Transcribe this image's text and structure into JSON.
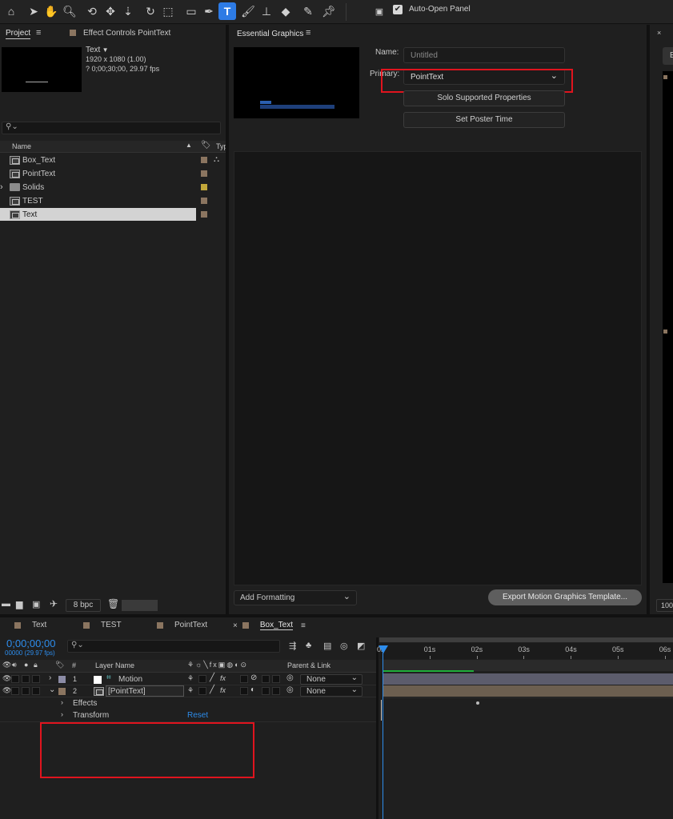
{
  "toolbar": {
    "auto_open_label": "Auto-Open Panel",
    "auto_open_checked": true
  },
  "project": {
    "tab_label": "Project",
    "effect_controls_label": "Effect Controls PointText",
    "preview_name": "Text",
    "preview_res": "1920 x 1080 (1.00)",
    "preview_dur": "? 0;00;30;00, 29.97 fps",
    "col_name": "Name",
    "col_type": "Typ",
    "items": [
      {
        "label": "Box_Text",
        "kind": "comp",
        "color": "#8b7560"
      },
      {
        "label": "PointText",
        "kind": "comp",
        "color": "#8b7560"
      },
      {
        "label": "Solids",
        "kind": "folder",
        "color": "#c2a83a"
      },
      {
        "label": "TEST",
        "kind": "comp",
        "color": "#8b7560"
      },
      {
        "label": "Text",
        "kind": "comp",
        "color": "#8b7560"
      }
    ],
    "bpc_label": "8 bpc"
  },
  "essential": {
    "tab_label": "Essential Graphics",
    "name_label": "Name:",
    "name_placeholder": "Untitled",
    "primary_label": "Primary:",
    "primary_value": "PointText",
    "solo_button": "Solo Supported Properties",
    "poster_button": "Set Poster Time",
    "add_formatting": "Add Formatting",
    "export_button": "Export Motion Graphics Template..."
  },
  "right_panel": {
    "short_label": "E",
    "zoom_label": "100"
  },
  "timeline": {
    "tabs": [
      {
        "label": "Text",
        "color": "#8b7560",
        "active": false
      },
      {
        "label": "TEST",
        "color": "#8b7560",
        "active": false
      },
      {
        "label": "PointText",
        "color": "#8b7560",
        "active": false
      },
      {
        "label": "Box_Text",
        "color": "#8b7560",
        "active": true
      }
    ],
    "timecode": "0;00;00;00",
    "frames": "00000 (29.97 fps)",
    "col_layer_name": "Layer Name",
    "col_number": "#",
    "col_parent": "Parent & Link",
    "layers": [
      {
        "number": "1",
        "name": "Motion",
        "color": "#8c8ca6",
        "parent": "None"
      },
      {
        "number": "2",
        "name": "[PointText]",
        "color": "#8b7560",
        "parent": "None"
      }
    ],
    "effects_label": "Effects",
    "transform_label": "Transform",
    "reset_label": "Reset",
    "ruler": [
      "0s",
      "01s",
      "02s",
      "03s",
      "04s",
      "05s",
      "06s"
    ]
  }
}
